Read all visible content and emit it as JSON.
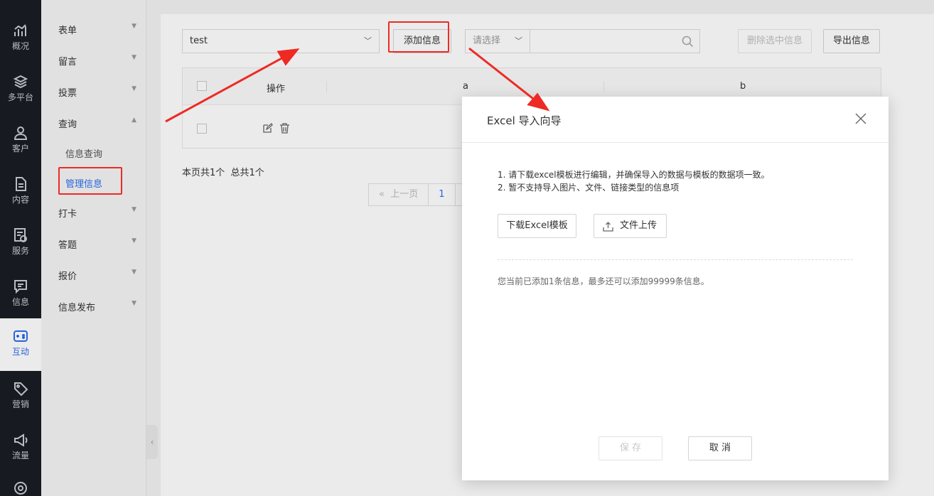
{
  "rail": {
    "items": [
      {
        "label": "概况",
        "icon": "chart-icon"
      },
      {
        "label": "多平台",
        "icon": "layers-icon"
      },
      {
        "label": "客户",
        "icon": "user-icon"
      },
      {
        "label": "内容",
        "icon": "document-icon"
      },
      {
        "label": "服务",
        "icon": "service-icon"
      },
      {
        "label": "信息",
        "icon": "message-icon"
      },
      {
        "label": "互动",
        "icon": "interact-icon"
      },
      {
        "label": "营销",
        "icon": "tag-icon"
      },
      {
        "label": "流量",
        "icon": "megaphone-icon"
      }
    ],
    "active_index": 6
  },
  "subnav": {
    "items": [
      {
        "label": "表单"
      },
      {
        "label": "留言"
      },
      {
        "label": "投票"
      },
      {
        "label": "查询"
      },
      {
        "label": "打卡"
      },
      {
        "label": "答题"
      },
      {
        "label": "报价"
      },
      {
        "label": "信息发布"
      }
    ],
    "query_children": [
      "信息查询",
      "管理信息"
    ]
  },
  "toolbar": {
    "dataset_select": "test",
    "add_button": "添加信息",
    "filter_placeholder": "请选择",
    "delete_button": "删除选中信息",
    "export_button": "导出信息"
  },
  "table": {
    "columns": [
      "操作",
      "a",
      "b"
    ]
  },
  "pagination": {
    "summary": "本页共1个  总共1个",
    "prev": "上一页",
    "current": "1"
  },
  "modal": {
    "title": "Excel 导入向导",
    "tip1": "1. 请下载excel模板进行编辑，并确保导入的数据与模板的数据项一致。",
    "tip2": "2. 暂不支持导入图片、文件、链接类型的信息项",
    "download_button": "下载Excel模板",
    "upload_button": "文件上传",
    "count_text": "您当前已添加1条信息，最多还可以添加99999条信息。",
    "save_button": "保 存",
    "cancel_button": "取 消"
  },
  "colors": {
    "accent": "#2c6cf0",
    "annotation_red": "#ee2a24",
    "rail_bg": "#1b1d24"
  }
}
